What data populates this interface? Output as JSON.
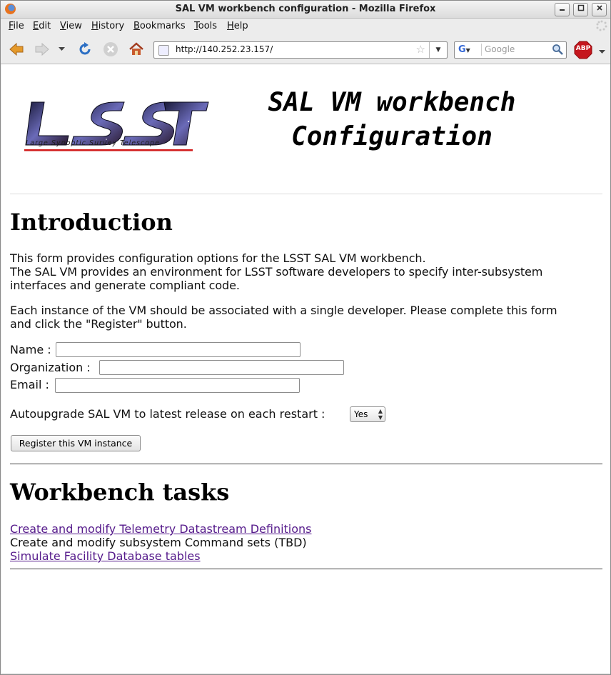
{
  "window": {
    "title": "SAL VM workbench configuration - Mozilla Firefox"
  },
  "menubar": {
    "items": [
      {
        "first": "F",
        "rest": "ile"
      },
      {
        "first": "E",
        "rest": "dit"
      },
      {
        "first": "V",
        "rest": "iew"
      },
      {
        "first": "H",
        "rest": "istory"
      },
      {
        "first": "B",
        "rest": "ookmarks"
      },
      {
        "first": "T",
        "rest": "ools"
      },
      {
        "first": "H",
        "rest": "elp"
      }
    ]
  },
  "navbar": {
    "url": "http://140.252.23.157/",
    "search_placeholder": "Google",
    "abp_label": "ABP"
  },
  "page": {
    "logo_caption": "Large Synoptic Survey Telescope",
    "title_line1": "SAL VM workbench",
    "title_line2": "Configuration",
    "intro_heading": "Introduction",
    "intro_p1_line1": "This form provides configuration options for the LSST SAL VM workbench.",
    "intro_p1_line2": "The SAL VM provides an environment for LSST software developers to specify inter-subsystem",
    "intro_p1_line3": "interfaces and generate compliant code.",
    "intro_p2_line1": "Each instance of the VM should be associated with a single developer. Please complete this form",
    "intro_p2_line2": "and click the \"Register\" button.",
    "form": {
      "name_label": "Name :",
      "name_value": "",
      "org_label": "Organization :",
      "org_value": "",
      "email_label": "Email :",
      "email_value": "",
      "autoupgrade_label": "Autoupgrade SAL VM to latest release on each restart :",
      "autoupgrade_value": "Yes",
      "register_button": "Register this VM instance"
    },
    "tasks_heading": "Workbench tasks",
    "tasks": {
      "telemetry_link": "Create and modify Telemetry Datastream Definitions",
      "commands_text": "Create and modify subsystem Command sets (TBD)",
      "facility_link": "Simulate Facility Database tables"
    }
  }
}
